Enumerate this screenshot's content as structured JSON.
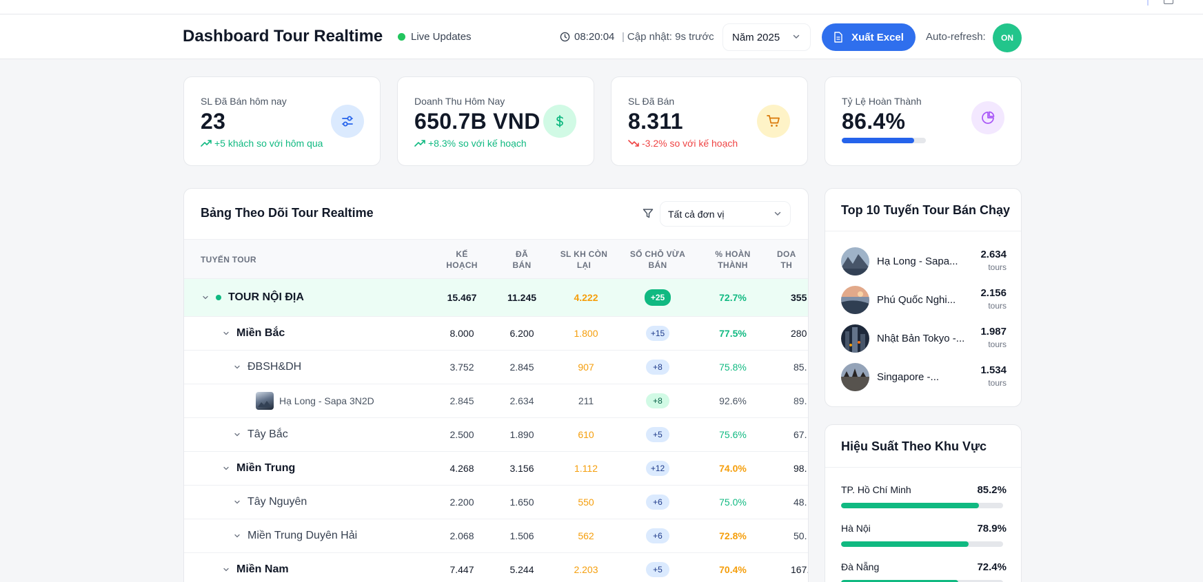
{
  "header": {
    "title": "Dashboard Tour Realtime",
    "live_label": "Live Updates",
    "time": "08:20:04",
    "updated": "Cập nhật: 9s trước",
    "year_select": "Năm 2025",
    "export_label": "Xuất Excel",
    "auto_refresh_label": "Auto-refresh:",
    "auto_refresh_state": "ON"
  },
  "kpis": [
    {
      "label": "SL Đã Bán hôm nay",
      "value": "23",
      "trend": "+5 khách so với hôm qua",
      "direction": "up",
      "icon": "sliders-icon",
      "color": "#dbeafe"
    },
    {
      "label": "Doanh Thu Hôm Nay",
      "value": "650.7B VND",
      "trend": "+8.3% so với kế hoạch",
      "direction": "up",
      "icon": "dollar-icon",
      "color": "#d1fae5"
    },
    {
      "label": "SL Đã Bán",
      "value": "8.311",
      "trend": "-3.2% so với kế hoạch",
      "direction": "down",
      "icon": "cart-icon",
      "color": "#fef3c7"
    },
    {
      "label": "Tỷ Lệ Hoàn Thành",
      "value": "86.4%",
      "progress": 0.864,
      "icon": "pie-chart-icon",
      "color": "#f3e8ff"
    }
  ],
  "table": {
    "title": "Bảng Theo Dõi Tour Realtime",
    "filter_value": "Tất cả đơn vị",
    "columns": [
      "TUYẾN TOUR",
      "KẾ\nHOẠCH",
      "ĐÃ\nBÁN",
      "SL KH CÒN\nLẠI",
      "SỐ CHỖ VỪA\nBÁN",
      "% HOÀN\nTHÀNH",
      "DOA\nTH"
    ],
    "rows": [
      {
        "name": "TOUR NỘI ĐỊA",
        "plan": "15.467",
        "sold": "11.245",
        "remaining": "4.222",
        "recent": "+25",
        "pct": "72.7%",
        "revenue": "355"
      },
      {
        "name": "Miền Bắc",
        "plan": "8.000",
        "sold": "6.200",
        "remaining": "1.800",
        "recent": "+15",
        "pct": "77.5%",
        "revenue": "280"
      },
      {
        "name": "ĐBSH&DH",
        "plan": "3.752",
        "sold": "2.845",
        "remaining": "907",
        "recent": "+8",
        "pct": "75.8%",
        "revenue": "85."
      },
      {
        "name": "Hạ Long - Sapa 3N2D",
        "plan": "2.845",
        "sold": "2.634",
        "remaining": "211",
        "recent": "+8",
        "pct": "92.6%",
        "revenue": "89."
      },
      {
        "name": "Tây Bắc",
        "plan": "2.500",
        "sold": "1.890",
        "remaining": "610",
        "recent": "+5",
        "pct": "75.6%",
        "revenue": "67."
      },
      {
        "name": "Miền Trung",
        "plan": "4.268",
        "sold": "3.156",
        "remaining": "1.112",
        "recent": "+12",
        "pct": "74.0%",
        "revenue": "98."
      },
      {
        "name": "Tây Nguyên",
        "plan": "2.200",
        "sold": "1.650",
        "remaining": "550",
        "recent": "+6",
        "pct": "75.0%",
        "revenue": "48."
      },
      {
        "name": "Miền Trung Duyên Hải",
        "plan": "2.068",
        "sold": "1.506",
        "remaining": "562",
        "recent": "+6",
        "pct": "72.8%",
        "revenue": "50."
      },
      {
        "name": "Miền Nam",
        "plan": "7.447",
        "sold": "5.244",
        "remaining": "2.203",
        "recent": "+5",
        "pct": "70.4%",
        "revenue": "167."
      }
    ]
  },
  "top10": {
    "title": "Top 10 Tuyến Tour Bán Chạy",
    "items": [
      {
        "name": "Hạ Long - Sapa...",
        "count": "2.634",
        "unit": "tours"
      },
      {
        "name": "Phú Quốc Nghi...",
        "count": "2.156",
        "unit": "tours"
      },
      {
        "name": "Nhật Bản Tokyo -...",
        "count": "1.987",
        "unit": "tours"
      },
      {
        "name": "Singapore -...",
        "count": "1.534",
        "unit": "tours"
      }
    ]
  },
  "performance": {
    "title": "Hiệu Suất Theo Khu Vực",
    "regions": [
      {
        "name": "TP. Hồ Chí Minh",
        "value": "85.2%",
        "fraction": 0.852
      },
      {
        "name": "Hà Nội",
        "value": "78.9%",
        "fraction": 0.789
      },
      {
        "name": "Đà Nẵng",
        "value": "72.4%",
        "fraction": 0.724
      }
    ]
  }
}
